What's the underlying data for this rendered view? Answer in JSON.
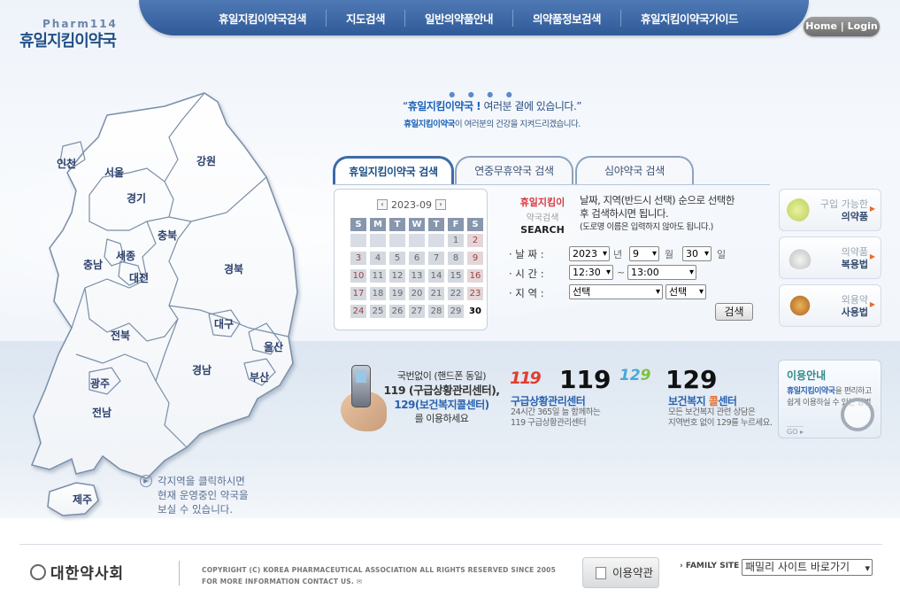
{
  "logo": {
    "en": "Pharm114",
    "ko": "휴일지킴이약국"
  },
  "nav": [
    "휴일지킴이약국검색",
    "지도검색",
    "일반의약품안내",
    "의약품정보검색",
    "휴일지킴이약국가이드"
  ],
  "home_login": "Home | Login",
  "slogan": {
    "line1_bold": "휴일지킴이약국 !",
    "line1_rest": " 여러분 곁에 있습니다.",
    "line2_bold": "휴일지킴이약국",
    "line2_rest": "이 여러분의 건강을 지켜드리겠습니다."
  },
  "map": {
    "regions": [
      "인천",
      "서울",
      "경기",
      "강원",
      "충북",
      "충남",
      "세종",
      "대전",
      "경북",
      "대구",
      "전북",
      "경남",
      "울산",
      "광주",
      "부산",
      "전남",
      "제주"
    ],
    "guide": [
      "각지역을 클릭하시면",
      "현재 운영중인 약국을",
      "보실 수 있습니다."
    ]
  },
  "tabs": [
    "휴일지킴이약국 검색",
    "연중무휴약국 검색",
    "심야약국 검색"
  ],
  "calendar": {
    "prev": "‹",
    "next": "›",
    "month": "2023-09",
    "dow": [
      "S",
      "M",
      "T",
      "W",
      "T",
      "F",
      "S"
    ],
    "weeks": [
      [
        "",
        "",
        "",
        "",
        "",
        "1",
        "2"
      ],
      [
        "3",
        "4",
        "5",
        "6",
        "7",
        "8",
        "9"
      ],
      [
        "10",
        "11",
        "12",
        "13",
        "14",
        "15",
        "16"
      ],
      [
        "17",
        "18",
        "19",
        "20",
        "21",
        "22",
        "23"
      ],
      [
        "24",
        "25",
        "26",
        "27",
        "28",
        "29",
        "30"
      ]
    ],
    "today": "30"
  },
  "search": {
    "title1": "휴일지킴이",
    "title2": "약국검색",
    "title3": "SEARCH",
    "desc1": "날짜, 지역(반드시 선택) 순으로 선택한",
    "desc2": "후 검색하시면 됩니다.",
    "desc3": "(도로명 이름은 입력하지 않아도 됩니다.)",
    "date_label": "· 날 짜 :",
    "year": "2023",
    "year_unit": "년",
    "month": "9",
    "month_unit": "월",
    "day": "30",
    "day_unit": "일",
    "time_label": "· 시 간 :",
    "time_from": "12:30",
    "time_sep": "~",
    "time_to": "13:00",
    "region_label": "· 지 역 :",
    "region1": "선택",
    "region2": "선택",
    "button": "검색"
  },
  "side_boxes": [
    {
      "sub": "구입 가능한",
      "main": "의약품"
    },
    {
      "sub": "의약품",
      "main": "복용법"
    },
    {
      "sub": "외용약",
      "main": "사용법"
    }
  ],
  "phone": {
    "l1": "국번없이 (핸드폰 동일)",
    "l2": "119 (구급상황관리센터),",
    "l3": "129(보건복지콜센터)",
    "l4": "를 이용하세요"
  },
  "b119": {
    "logo": "119",
    "num": "119",
    "name": "구급상황관리센터",
    "desc1": "24시간 365일 늘 함께하는",
    "desc2": "119 구급상황관리센터"
  },
  "b129": {
    "num": "129",
    "name_pre": "보건복지 ",
    "name_em": "콜",
    "name_post": "센터",
    "desc1": "모든 보건복지 관련 상담은",
    "desc2": "지역번호 없이 129를 누르세요."
  },
  "guide_box": {
    "title": "이용안내",
    "d_bold": "휴일지킴이약국",
    "d_rest": "을 편리하고 쉽게 이용하실 수 있는 방법",
    "go": "GO ▸"
  },
  "footer": {
    "logo": "대한약사회",
    "copy1": "COPYRIGHT (C) KOREA PHARMACEUTICAL ASSOCIATION ALL RIGHTS RESERVED SINCE 2005",
    "copy2": "FOR MORE INFORMATION CONTACT US. ✉",
    "terms": "이용약관",
    "family_label": "› FAMILY SITE",
    "family_select": "패밀리 사이트 바로가기"
  }
}
